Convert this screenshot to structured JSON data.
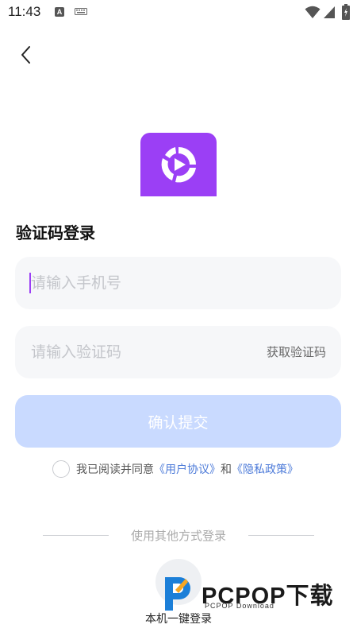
{
  "status_bar": {
    "time": "11:43",
    "icons": [
      "accessibility-a-icon",
      "keyboard-icon",
      "wifi-icon",
      "signal-icon",
      "battery-charging-icon"
    ]
  },
  "header": {
    "back_icon": "chevron-left-icon"
  },
  "brand": {
    "logo_icon": "app-logo-play-icon",
    "accent_color": "#9b3ff5"
  },
  "login": {
    "title": "验证码登录",
    "phone_placeholder": "请输入手机号",
    "code_placeholder": "请输入验证码",
    "get_code_label": "获取验证码",
    "submit_label": "确认提交",
    "submit_color": "#c9daff"
  },
  "agreement": {
    "prefix": "我已阅读并同意",
    "user_agreement": "《用户协议》",
    "and": "和",
    "privacy_policy": "《隐私政策》",
    "link_color": "#4d7bd9"
  },
  "other_login": {
    "divider_label": "使用其他方式登录",
    "quick_login_label": "本机一键登录"
  },
  "watermark": {
    "brand": "PCPOP下载",
    "sub": "PCPOP Download"
  }
}
